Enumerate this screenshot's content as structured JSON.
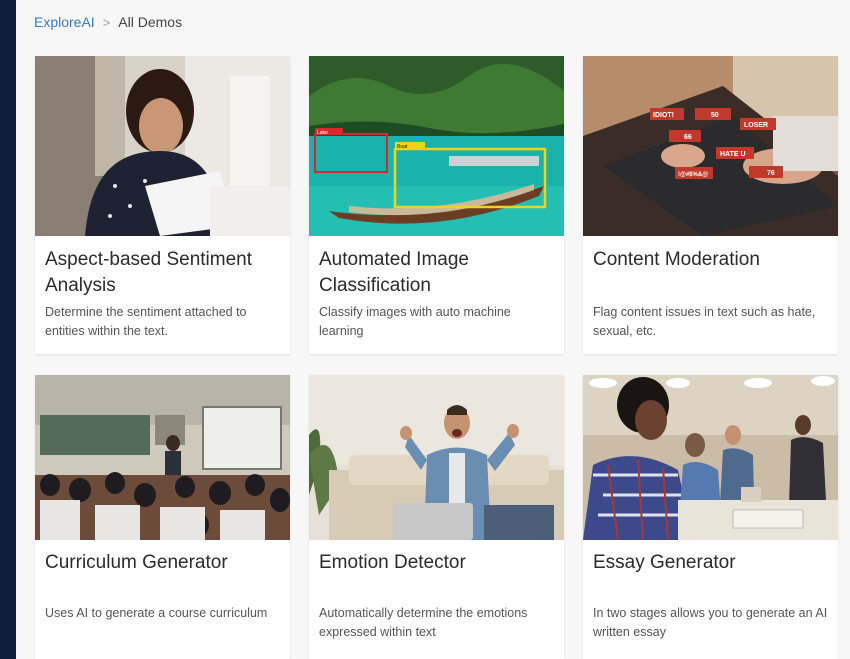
{
  "breadcrumb": {
    "root": "ExploreAI",
    "separator": ">",
    "current": "All Demos"
  },
  "cards": [
    {
      "title": "Aspect-based Sentiment Analysis",
      "description": "Determine the sentiment attached to entities within the text.",
      "image": "woman-reading-photo"
    },
    {
      "title": "Automated Image Classification",
      "description": "Classify images with auto machine learning",
      "image": "boat-lake-photo",
      "tags": [
        "Lake",
        "Boat"
      ]
    },
    {
      "title": "Content Moderation",
      "description": "Flag content issues in text such as hate, sexual, etc.",
      "image": "laptop-typing-photo",
      "tags": [
        "IDIOT!",
        "50",
        "66",
        "LOSER",
        "HATE U",
        "!@#$%&@",
        "76"
      ]
    },
    {
      "title": "Curriculum Generator",
      "description": "Uses AI to generate a course curriculum",
      "image": "classroom-photo"
    },
    {
      "title": "Emotion Detector",
      "description": "Automatically determine the emotions expressed within text",
      "image": "excited-man-photo"
    },
    {
      "title": "Essay Generator",
      "description": "In two stages allows you to generate an AI written essay",
      "image": "students-writing-photo"
    }
  ],
  "colors": {
    "background": "#0e1f3e",
    "page": "#f7f7f7",
    "link": "#3a7bbf",
    "tag_red": "#c0392b",
    "tag_yellow": "#f2d31b"
  }
}
